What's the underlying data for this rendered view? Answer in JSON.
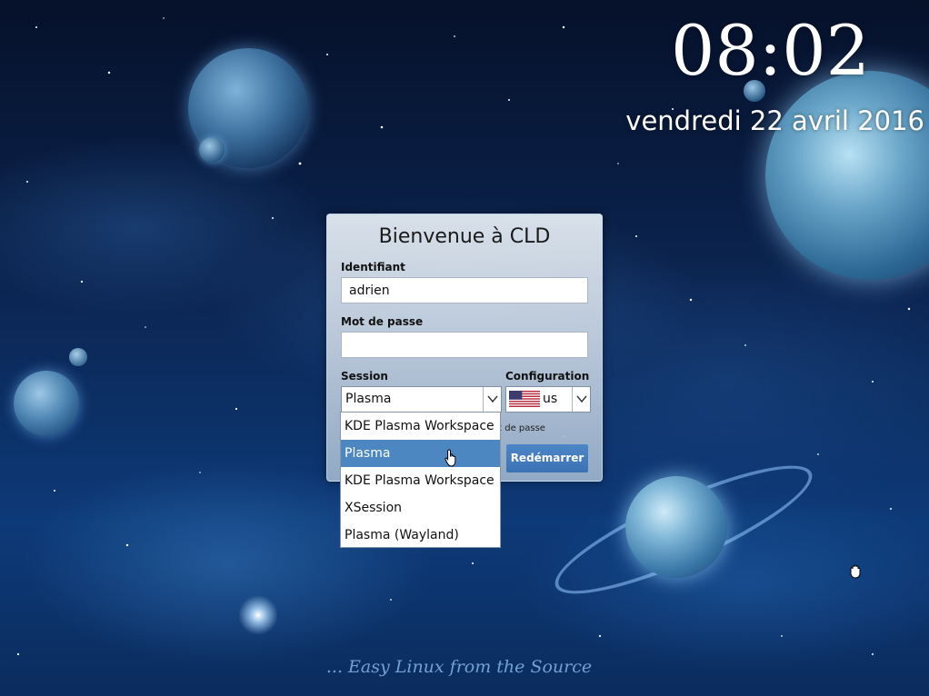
{
  "clock": {
    "time": "08:02",
    "date": "vendredi 22 avril 2016"
  },
  "login": {
    "title": "Bienvenue à CLD",
    "username_label": "Identifiant",
    "username_value": "adrien",
    "password_label": "Mot de passe",
    "password_value": "",
    "session_label": "Session",
    "session_value": "Plasma",
    "configuration_label": "Configuration",
    "keyboard_layout": "us",
    "keyboard_flag_icon": "us-flag-icon",
    "partial_text": "ot de passe",
    "restart_label": "Redémarrer"
  },
  "session_dropdown": {
    "options": [
      {
        "label": "KDE Plasma Workspace",
        "selected": false
      },
      {
        "label": "Plasma",
        "selected": true
      },
      {
        "label": "KDE Plasma Workspace",
        "selected": false
      },
      {
        "label": "XSession",
        "selected": false
      },
      {
        "label": "Plasma (Wayland)",
        "selected": false
      }
    ]
  },
  "wallpaper": {
    "tagline": "... Easy Linux from the Source"
  },
  "colors": {
    "accent": "#4d87c2",
    "button": "#3b72b4",
    "background": "#0b2450"
  }
}
